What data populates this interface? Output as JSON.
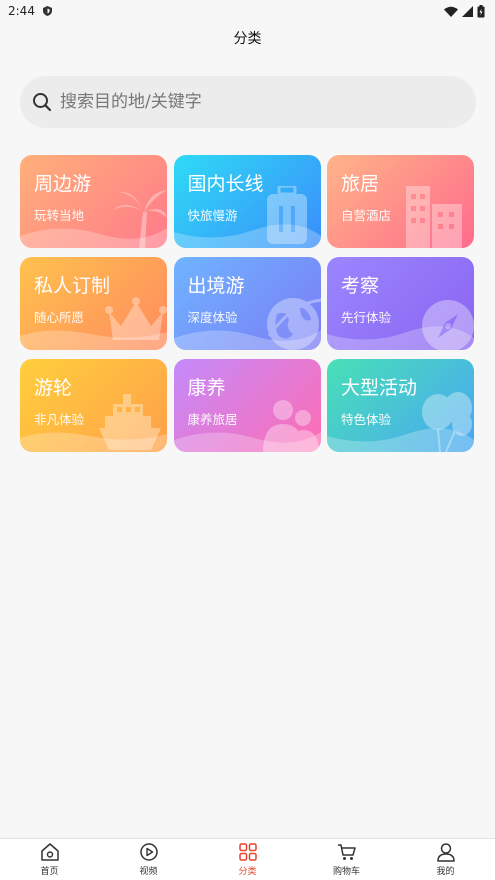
{
  "status": {
    "time": "2:44"
  },
  "header": {
    "title": "分类"
  },
  "search": {
    "placeholder": "搜索目的地/关键字"
  },
  "categories": [
    {
      "title": "周边游",
      "subtitle": "玩转当地",
      "icon": "palm-tree-icon"
    },
    {
      "title": "国内长线",
      "subtitle": "快旅慢游",
      "icon": "suitcase-icon"
    },
    {
      "title": "旅居",
      "subtitle": "自营酒店",
      "icon": "building-icon"
    },
    {
      "title": "私人订制",
      "subtitle": "随心所愿",
      "icon": "crown-icon"
    },
    {
      "title": "出境游",
      "subtitle": "深度体验",
      "icon": "globe-plane-icon"
    },
    {
      "title": "考察",
      "subtitle": "先行体验",
      "icon": "compass-icon"
    },
    {
      "title": "游轮",
      "subtitle": "非凡体验",
      "icon": "cruise-ship-icon"
    },
    {
      "title": "康养",
      "subtitle": "康养旅居",
      "icon": "people-icon"
    },
    {
      "title": "大型活动",
      "subtitle": "特色体验",
      "icon": "balloons-icon"
    }
  ],
  "tabs": [
    {
      "label": "首页",
      "icon": "home-icon",
      "active": false
    },
    {
      "label": "视频",
      "icon": "play-icon",
      "active": false
    },
    {
      "label": "分类",
      "icon": "category-grid-icon",
      "active": true
    },
    {
      "label": "购物车",
      "icon": "cart-icon",
      "active": false
    },
    {
      "label": "我的",
      "icon": "user-icon",
      "active": false
    }
  ],
  "colors": {
    "accent": "#e8452f",
    "background": "#f7f7f7"
  }
}
